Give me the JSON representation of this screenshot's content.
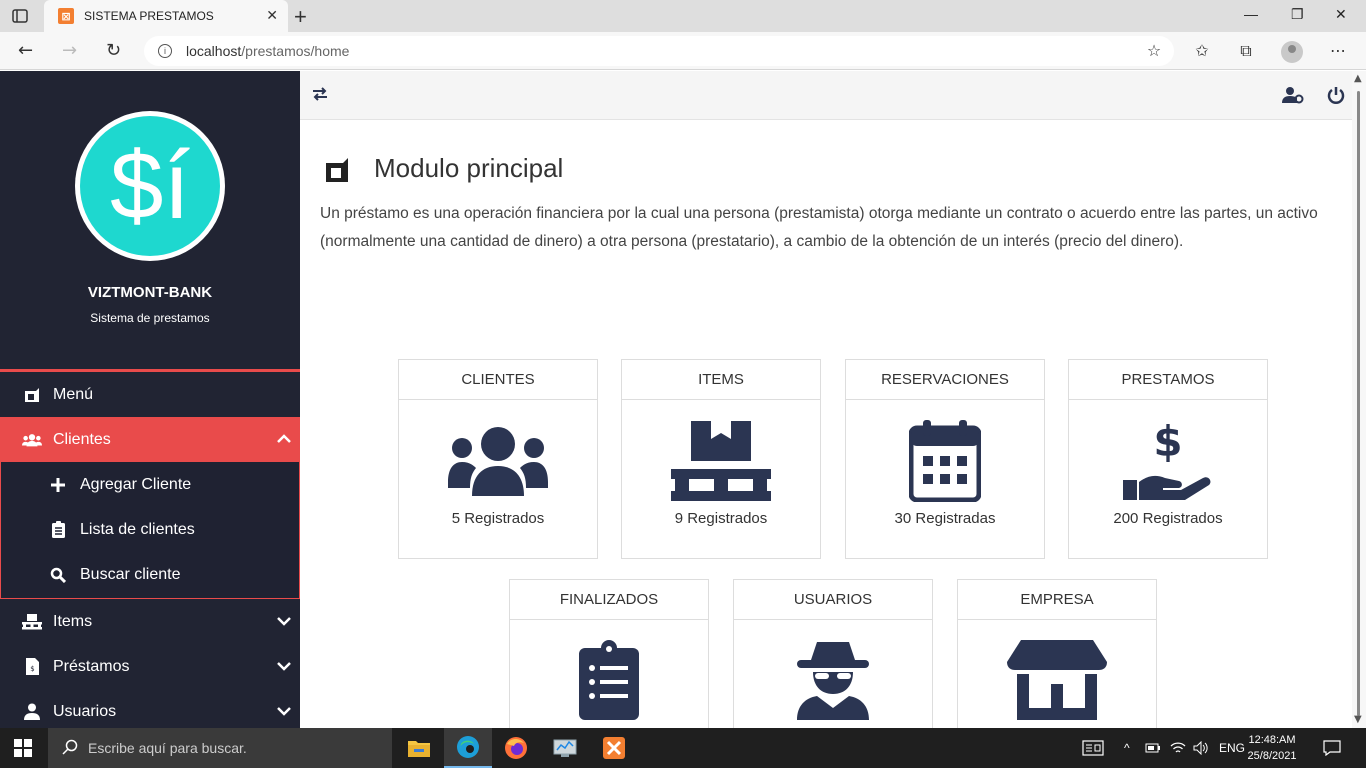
{
  "browser": {
    "tab_title": "SISTEMA PRESTAMOS",
    "url_host": "localhost",
    "url_path": "/prestamos/home"
  },
  "sidebar": {
    "logo_text": "$í",
    "bank_name": "VIZTMONT-BANK",
    "subtitle": "Sistema de prestamos",
    "items": [
      {
        "label": "Menú",
        "icon": "menu-icon"
      },
      {
        "label": "Clientes",
        "icon": "users-icon",
        "active": true
      },
      {
        "label": "Items",
        "icon": "pallet-icon"
      },
      {
        "label": "Préstamos",
        "icon": "invoice-icon"
      },
      {
        "label": "Usuarios",
        "icon": "user-icon"
      }
    ],
    "submenu": [
      {
        "label": "Agregar Cliente",
        "icon": "plus-icon"
      },
      {
        "label": "Lista de clientes",
        "icon": "clipboard-icon"
      },
      {
        "label": "Buscar cliente",
        "icon": "search-icon"
      }
    ],
    "accent_color": "#e94b4b"
  },
  "main": {
    "title": "Modulo principal",
    "description": "Un préstamo es una operación financiera por la cual una persona (prestamista) otorga mediante un contrato o acuerdo entre las partes, un activo (normalmente una cantidad de dinero) a otra persona (prestatario), a cambio de la obtención de un interés (precio del dinero).",
    "cards": [
      {
        "title": "CLIENTES",
        "count": "5 Registrados",
        "icon": "users-icon"
      },
      {
        "title": "ITEMS",
        "count": "9 Registrados",
        "icon": "pallet-icon"
      },
      {
        "title": "RESERVACIONES",
        "count": "30 Registradas",
        "icon": "calendar-icon"
      },
      {
        "title": "PRESTAMOS",
        "count": "200 Registrados",
        "icon": "hand-dollar-icon"
      },
      {
        "title": "FINALIZADOS",
        "count": "",
        "icon": "clipboard-list-icon"
      },
      {
        "title": "USUARIOS",
        "count": "",
        "icon": "spy-icon"
      },
      {
        "title": "EMPRESA",
        "count": "",
        "icon": "store-icon"
      }
    ],
    "icon_color": "#2b3552"
  },
  "taskbar": {
    "search_placeholder": "Escribe aquí para buscar.",
    "language": "ENG",
    "time": "12:48:AM",
    "date": "25/8/2021"
  }
}
